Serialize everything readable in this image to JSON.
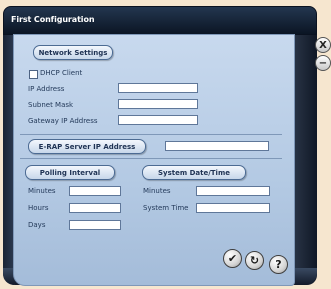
{
  "window": {
    "title": "First Configuration"
  },
  "controls": {
    "close_symbol": "X",
    "minimize_symbol": "−"
  },
  "network": {
    "heading": "Network Settings",
    "dhcp_label": "DHCP Client",
    "dhcp_checked": false,
    "ip_label": "IP Address",
    "ip_value": "",
    "mask_label": "Subnet Mask",
    "mask_value": "",
    "gateway_label": "Gateway IP Address",
    "gateway_value": ""
  },
  "erap": {
    "heading": "E-RAP Server IP Address",
    "value": ""
  },
  "polling": {
    "heading": "Polling Interval",
    "minutes_label": "Minutes",
    "minutes_value": "",
    "hours_label": "Hours",
    "hours_value": "",
    "days_label": "Days",
    "days_value": ""
  },
  "system_datetime": {
    "heading": "System Date/Time",
    "minutes_label": "Minutes",
    "minutes_value": "",
    "time_label": "System Time",
    "time_value": ""
  },
  "footer": {
    "ok_symbol": "✔",
    "reset_symbol": "↻",
    "help_symbol": "?"
  },
  "icons": [
    "close-icon",
    "minimize-icon",
    "checkmark-icon",
    "refresh-icon",
    "help-icon"
  ]
}
